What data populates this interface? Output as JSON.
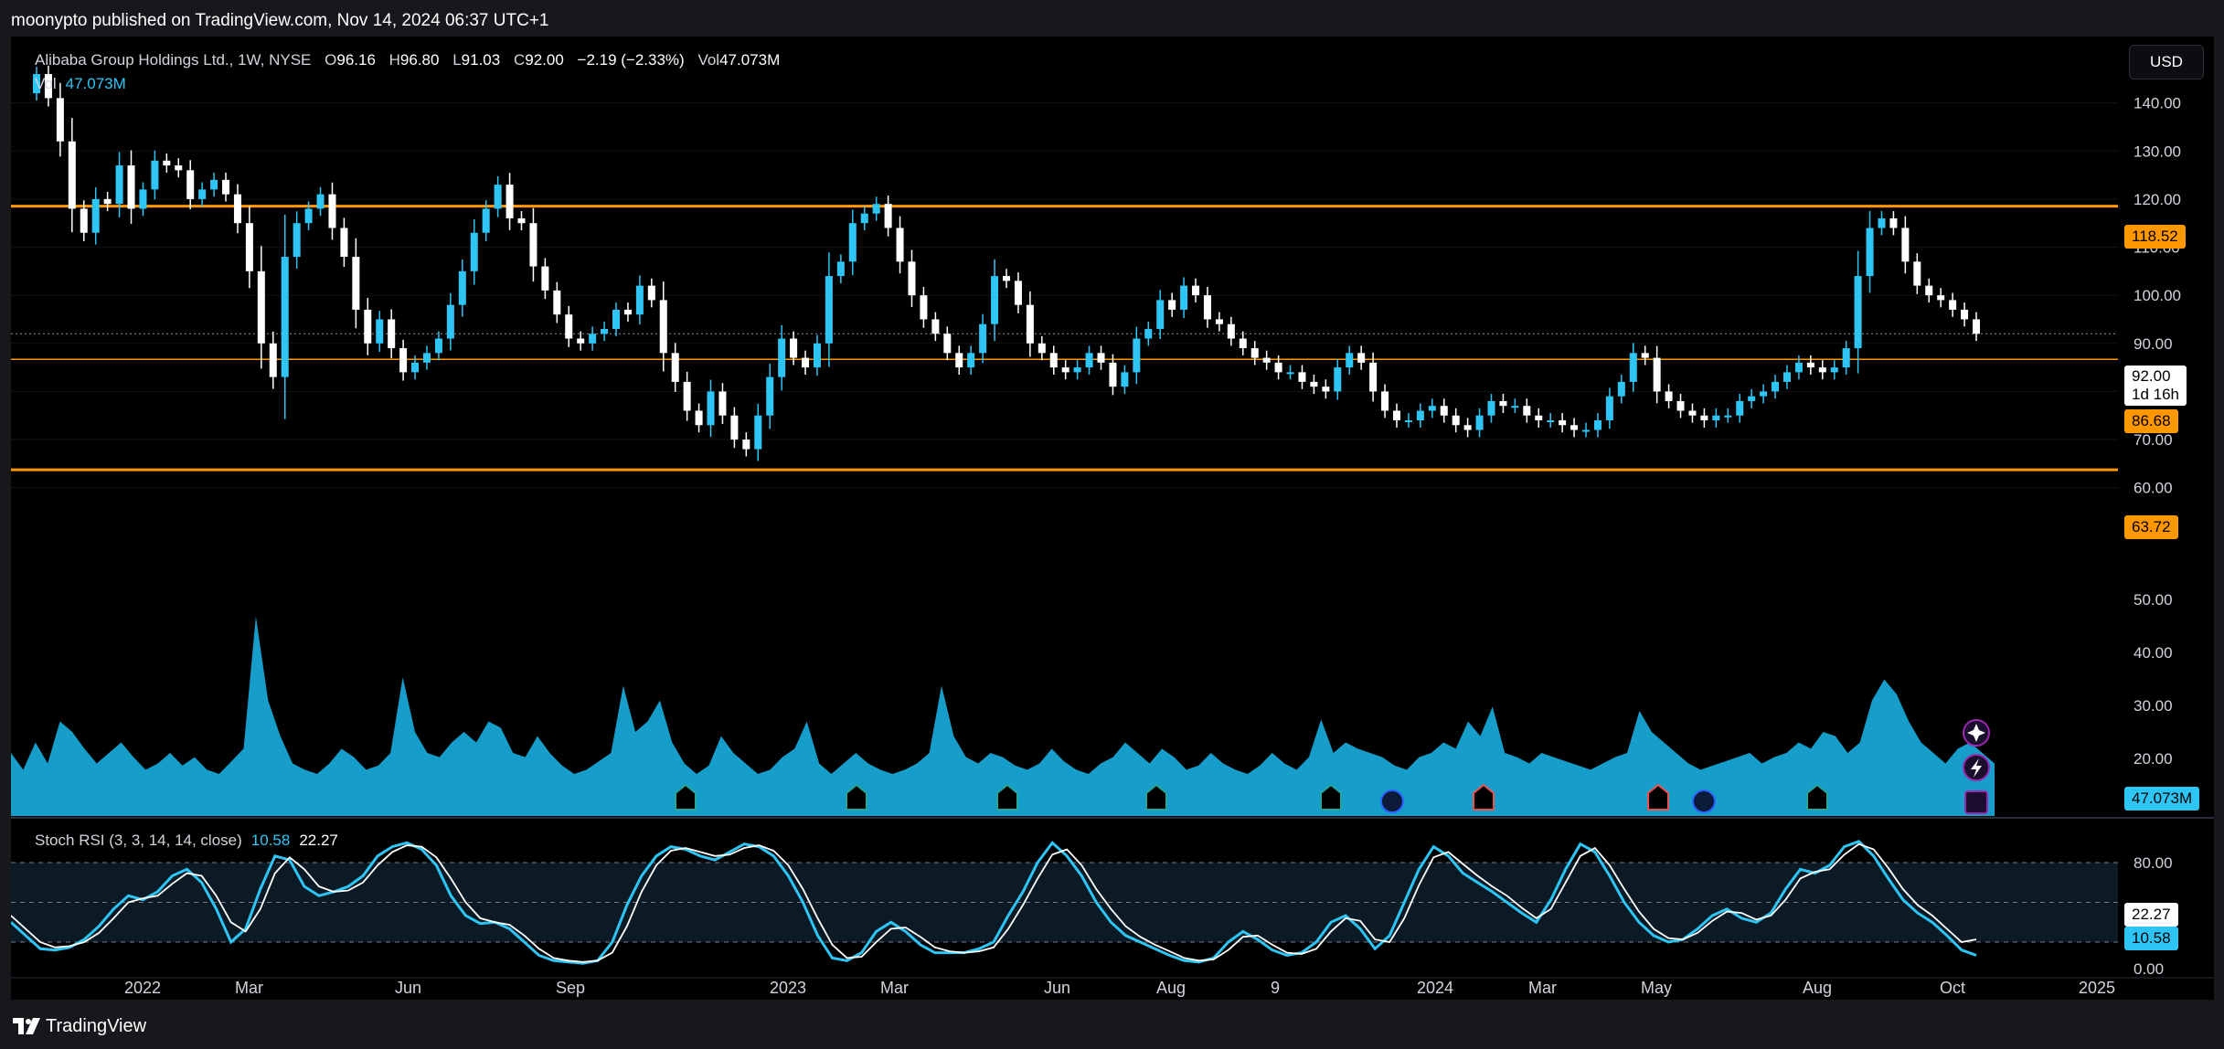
{
  "published_by": "moonypto published on TradingView.com, Nov 14, 2024 06:37 UTC+1",
  "footer_brand": "TradingView",
  "currency": "USD",
  "legend": {
    "symbol": "Alibaba Group Holdings Ltd., 1W, NYSE",
    "open_label": "O",
    "open": "96.16",
    "high_label": "H",
    "high": "96.80",
    "low_label": "L",
    "low": "91.03",
    "close_label": "C",
    "close": "92.00",
    "change": "−2.19 (−2.33%)",
    "vol_label": "Vol",
    "vol": "47.073M"
  },
  "volume_legend": {
    "label": "Vol",
    "value": "47.073M"
  },
  "stoch_legend": {
    "label": "Stoch RSI (3, 3, 14, 14, close)",
    "k": "10.58",
    "d": "22.27"
  },
  "price_labels": {
    "resistance": "118.52",
    "current": "92.00",
    "countdown": "1d 16h",
    "support1": "86.68",
    "support2": "63.72",
    "volume": "47.073M",
    "stoch_d": "22.27",
    "stoch_k": "10.58"
  },
  "colors": {
    "up": "#2ec5f5",
    "down": "#ffffff",
    "level_line": "#ff9800",
    "stoch_k": "#2ec5f5",
    "stoch_d": "#ffffff",
    "background": "#000000"
  },
  "icons": [
    "sparkle-icon",
    "lightning-icon",
    "earnings-icon"
  ],
  "chart_data": [
    {
      "type": "candlestick",
      "title": "Alibaba Group Holdings Ltd., 1W, NYSE",
      "ylim": [
        55,
        150
      ],
      "yticks": [
        60,
        70,
        80,
        90,
        100,
        110,
        120,
        130,
        140
      ],
      "xticks": [
        "2022",
        "Mar",
        "Jun",
        "Sep",
        "2023",
        "Mar",
        "Jun",
        "Aug",
        "9",
        "2024",
        "Mar",
        "May",
        "Aug",
        "Oct",
        "2025"
      ],
      "horizontal_levels": [
        118.52,
        86.68,
        63.72
      ],
      "current_price": 92.0,
      "closes": [
        146,
        141,
        132,
        118,
        113,
        120,
        119,
        127,
        118,
        122,
        128,
        127,
        126,
        120,
        122,
        124,
        121,
        115,
        105,
        90,
        83,
        108,
        115,
        118,
        121,
        114,
        108,
        97,
        90,
        95,
        89,
        84,
        86,
        88,
        91,
        98,
        105,
        113,
        118,
        123,
        116,
        115,
        106,
        101,
        96,
        91,
        90,
        92,
        93,
        97,
        96,
        102,
        99,
        88,
        82,
        76,
        73,
        80,
        75,
        70,
        68,
        75,
        83,
        91,
        87,
        85,
        90,
        104,
        107,
        115,
        117,
        119,
        114,
        107,
        100,
        95,
        92,
        88,
        85,
        88,
        94,
        104,
        103,
        98,
        90,
        88,
        85,
        84,
        85,
        88,
        86,
        81,
        84,
        91,
        93,
        99,
        97,
        102,
        100,
        95,
        94,
        91,
        89,
        87,
        86,
        84,
        84,
        82,
        81,
        80,
        85,
        88,
        86,
        80,
        76,
        74,
        74,
        76,
        77,
        75,
        73,
        72,
        75,
        78,
        77,
        77,
        75,
        74,
        74,
        73,
        72,
        72,
        74,
        79,
        82,
        88,
        87,
        80,
        78,
        76,
        75,
        74,
        75,
        75,
        78,
        79,
        80,
        82,
        84,
        86,
        85,
        84,
        85,
        89,
        104,
        114,
        116,
        114,
        107,
        102,
        100,
        99,
        97,
        95,
        92
      ],
      "volume_levels": [
        0.3,
        0.22,
        0.35,
        0.25,
        0.45,
        0.4,
        0.32,
        0.25,
        0.3,
        0.35,
        0.28,
        0.22,
        0.25,
        0.3,
        0.24,
        0.28,
        0.22,
        0.2,
        0.26,
        0.32,
        0.95,
        0.55,
        0.38,
        0.25,
        0.22,
        0.2,
        0.25,
        0.32,
        0.28,
        0.22,
        0.24,
        0.3,
        0.66,
        0.4,
        0.3,
        0.28,
        0.35,
        0.4,
        0.35,
        0.45,
        0.42,
        0.3,
        0.28,
        0.38,
        0.3,
        0.24,
        0.2,
        0.22,
        0.26,
        0.3,
        0.62,
        0.4,
        0.45,
        0.55,
        0.35,
        0.25,
        0.2,
        0.24,
        0.38,
        0.3,
        0.25,
        0.2,
        0.22,
        0.28,
        0.32,
        0.45,
        0.25,
        0.2,
        0.25,
        0.3,
        0.25,
        0.22,
        0.2,
        0.22,
        0.25,
        0.3,
        0.62,
        0.38,
        0.28,
        0.25,
        0.3,
        0.28,
        0.24,
        0.22,
        0.25,
        0.32,
        0.26,
        0.22,
        0.2,
        0.25,
        0.28,
        0.35,
        0.3,
        0.25,
        0.32,
        0.28,
        0.22,
        0.24,
        0.3,
        0.25,
        0.22,
        0.2,
        0.24,
        0.3,
        0.25,
        0.22,
        0.28,
        0.46,
        0.3,
        0.35,
        0.32,
        0.3,
        0.28,
        0.24,
        0.22,
        0.28,
        0.3,
        0.35,
        0.32,
        0.45,
        0.38,
        0.52,
        0.3,
        0.28,
        0.25,
        0.3,
        0.28,
        0.26,
        0.24,
        0.22,
        0.25,
        0.28,
        0.3,
        0.5,
        0.4,
        0.35,
        0.3,
        0.25,
        0.22,
        0.24,
        0.26,
        0.28,
        0.3,
        0.25,
        0.28,
        0.3,
        0.35,
        0.32,
        0.4,
        0.38,
        0.3,
        0.35,
        0.55,
        0.65,
        0.58,
        0.45,
        0.35,
        0.3,
        0.25,
        0.32,
        0.35,
        0.3,
        0.25
      ]
    },
    {
      "type": "line",
      "title": "Stoch RSI (3, 3, 14, 14, close)",
      "ylim": [
        0,
        100
      ],
      "yticks": [
        0,
        20,
        40,
        80
      ],
      "bands": [
        80,
        50,
        20
      ],
      "series": [
        {
          "name": "K",
          "last": 10.58,
          "values": [
            35,
            25,
            15,
            14,
            16,
            22,
            32,
            45,
            55,
            52,
            58,
            70,
            75,
            65,
            45,
            20,
            30,
            60,
            85,
            82,
            62,
            55,
            58,
            62,
            70,
            85,
            92,
            95,
            90,
            78,
            55,
            40,
            34,
            35,
            30,
            20,
            10,
            6,
            5,
            4,
            6,
            20,
            48,
            70,
            85,
            92,
            90,
            85,
            82,
            88,
            94,
            92,
            85,
            70,
            50,
            25,
            8,
            6,
            12,
            28,
            35,
            28,
            18,
            12,
            12,
            12,
            15,
            20,
            40,
            58,
            80,
            95,
            85,
            70,
            50,
            35,
            25,
            20,
            15,
            10,
            6,
            5,
            8,
            20,
            28,
            22,
            14,
            10,
            12,
            20,
            35,
            40,
            30,
            15,
            25,
            50,
            75,
            92,
            85,
            72,
            65,
            58,
            50,
            42,
            35,
            52,
            75,
            94,
            88,
            70,
            50,
            35,
            25,
            20,
            22,
            30,
            40,
            45,
            38,
            35,
            42,
            60,
            75,
            72,
            78,
            92,
            96,
            85,
            68,
            52,
            42,
            35,
            25,
            14,
            10
          ]
        },
        {
          "name": "D",
          "last": 22.27,
          "values": [
            40,
            30,
            20,
            16,
            17,
            20,
            27,
            38,
            50,
            53,
            55,
            64,
            72,
            70,
            55,
            35,
            28,
            45,
            72,
            84,
            75,
            62,
            58,
            59,
            65,
            78,
            88,
            93,
            92,
            84,
            68,
            50,
            38,
            35,
            33,
            25,
            15,
            8,
            6,
            5,
            6,
            12,
            32,
            58,
            78,
            89,
            91,
            88,
            85,
            86,
            91,
            93,
            89,
            78,
            60,
            38,
            18,
            8,
            9,
            20,
            30,
            31,
            24,
            16,
            13,
            12,
            13,
            16,
            30,
            48,
            68,
            86,
            90,
            78,
            60,
            45,
            32,
            24,
            18,
            13,
            8,
            6,
            7,
            14,
            24,
            25,
            18,
            12,
            11,
            15,
            28,
            38,
            36,
            22,
            20,
            38,
            63,
            84,
            88,
            79,
            70,
            62,
            55,
            46,
            38,
            45,
            65,
            85,
            91,
            78,
            60,
            43,
            30,
            23,
            22,
            27,
            36,
            43,
            42,
            37,
            40,
            52,
            68,
            73,
            75,
            86,
            94,
            90,
            76,
            60,
            48,
            40,
            30,
            20,
            22
          ]
        }
      ]
    }
  ]
}
